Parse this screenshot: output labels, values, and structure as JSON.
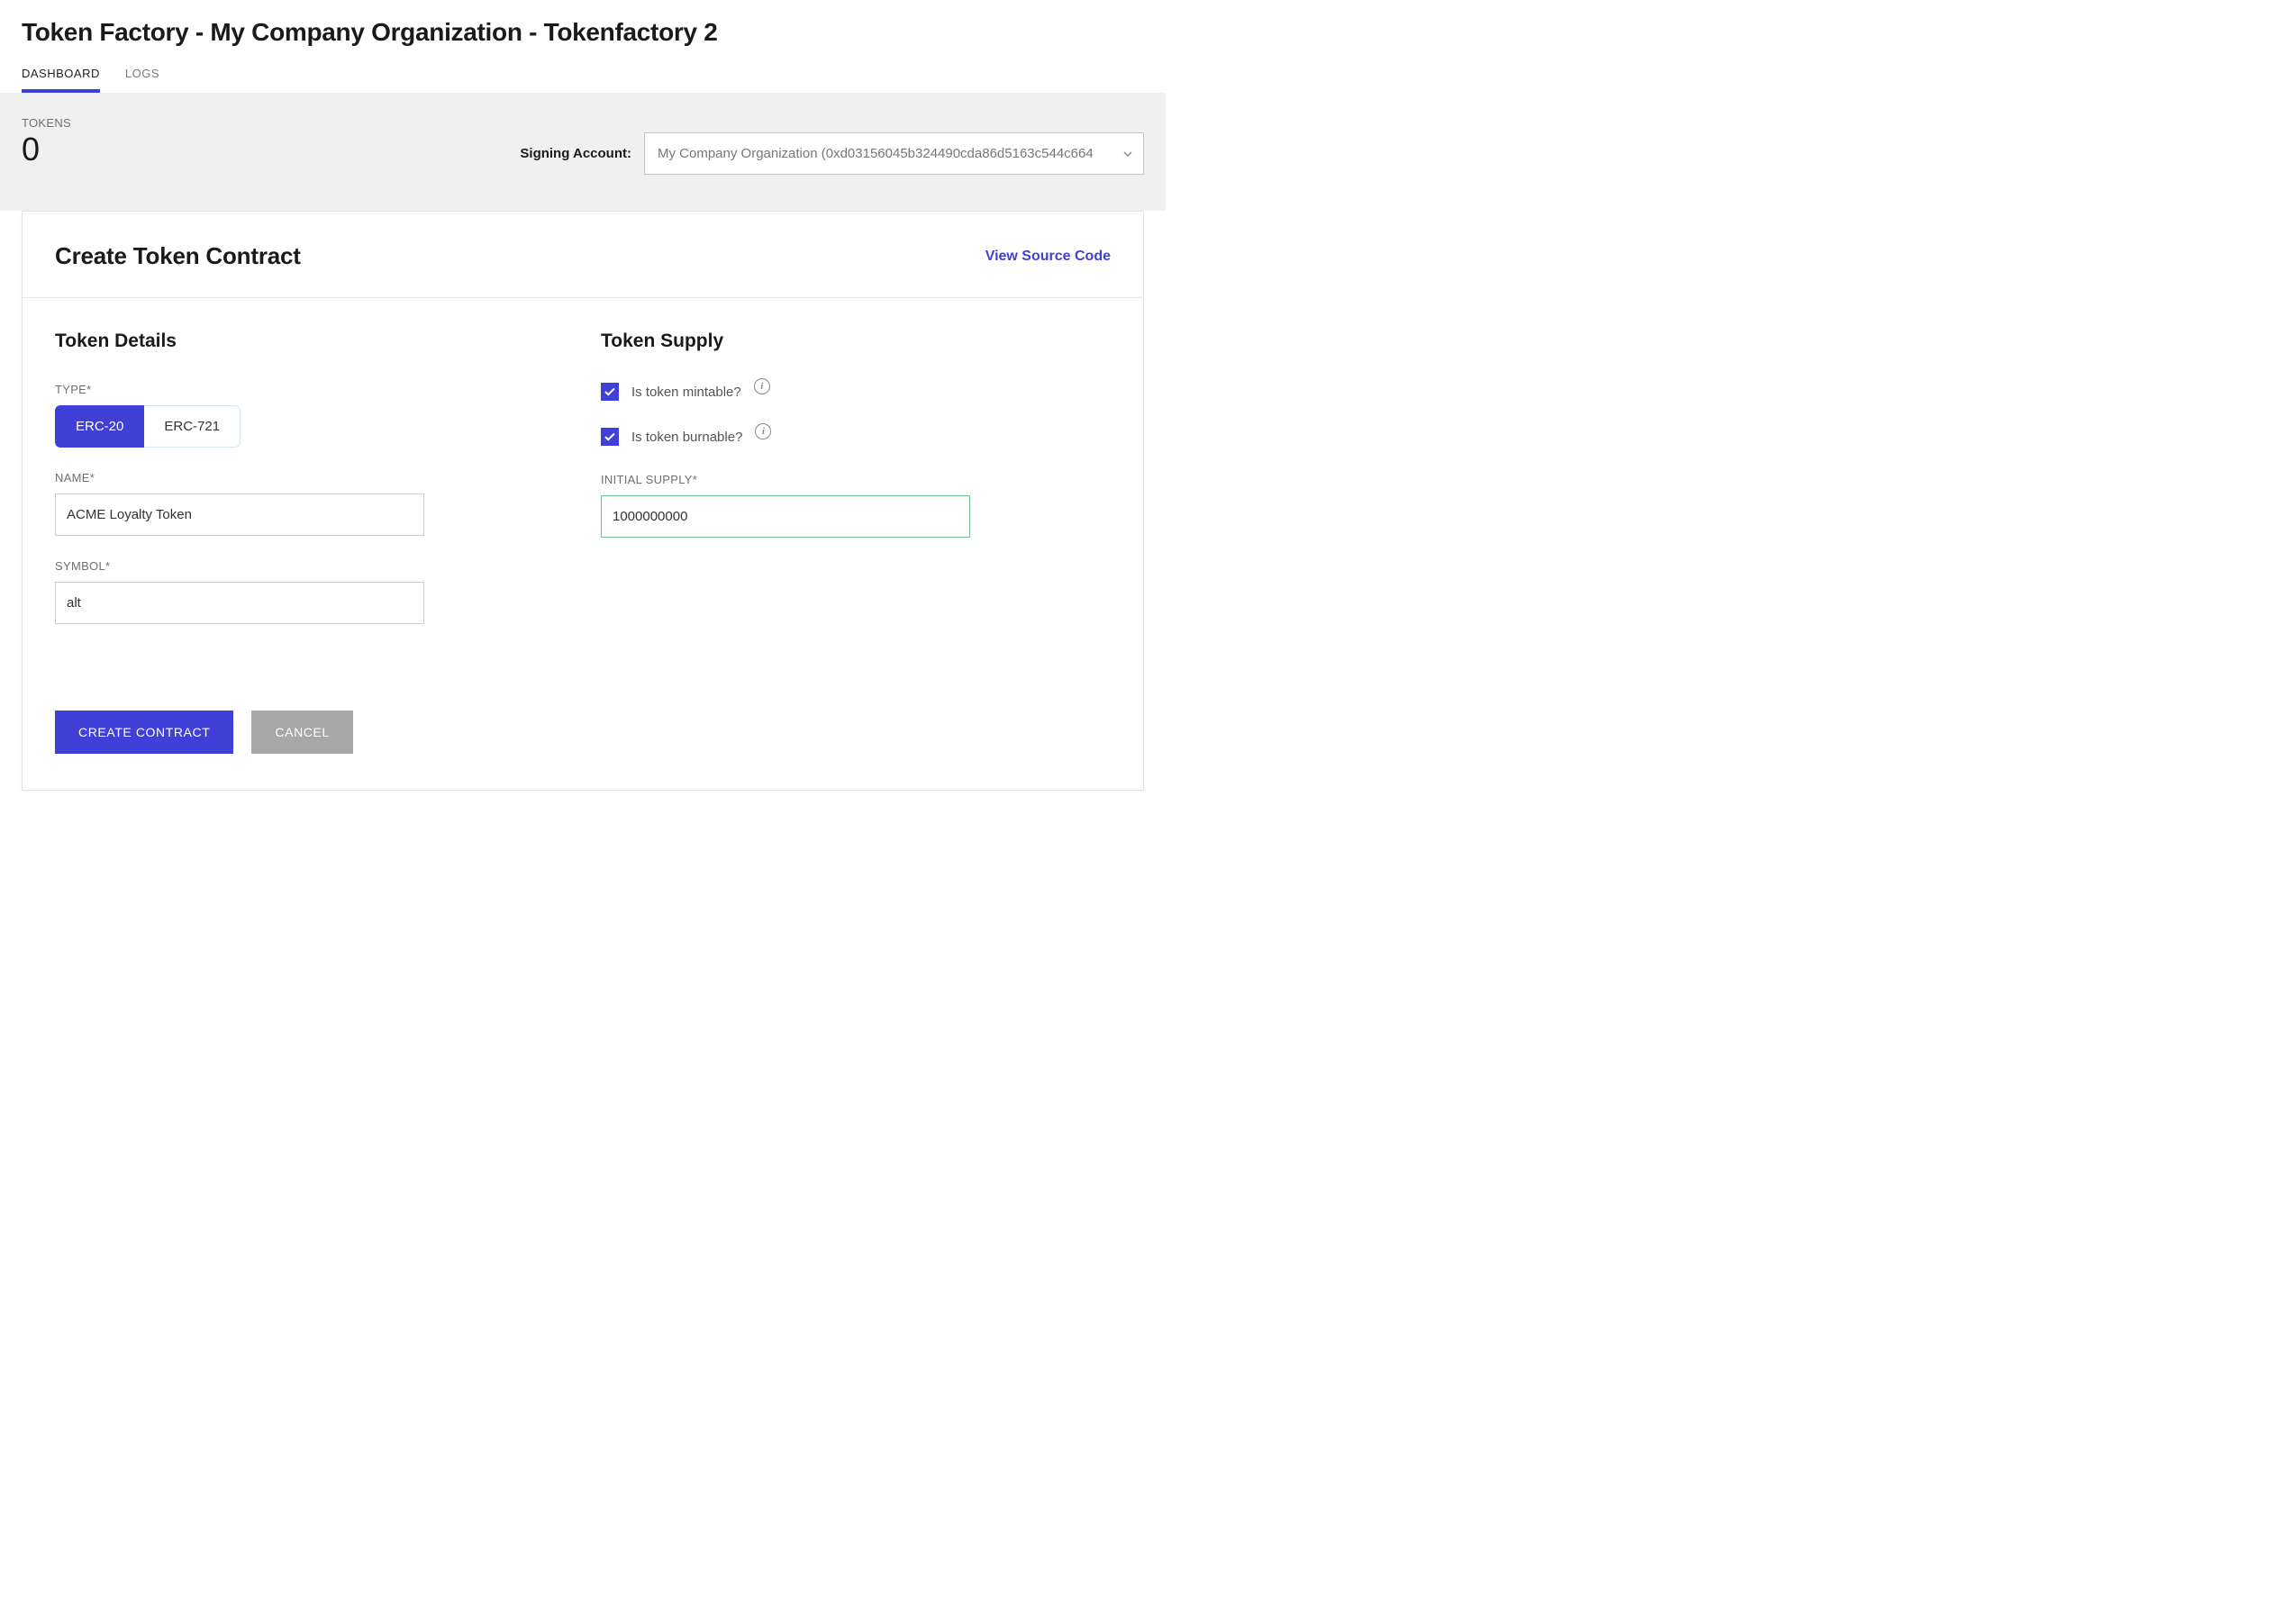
{
  "header": {
    "title": "Token Factory - My Company Organization - Tokenfactory 2"
  },
  "tabs": [
    {
      "label": "DASHBOARD",
      "active": true
    },
    {
      "label": "LOGS",
      "active": false
    }
  ],
  "stats": {
    "tokens_label": "TOKENS",
    "tokens_value": "0",
    "signing_label": "Signing Account:",
    "signing_value": "My Company Organization (0xd03156045b324490cda86d5163c544c664"
  },
  "card": {
    "title": "Create Token Contract",
    "view_source": "View Source Code"
  },
  "details": {
    "section_title": "Token Details",
    "type_label": "TYPE*",
    "type_options": [
      "ERC-20",
      "ERC-721"
    ],
    "type_selected": "ERC-20",
    "name_label": "NAME*",
    "name_value": "ACME Loyalty Token",
    "symbol_label": "SYMBOL*",
    "symbol_value": "alt"
  },
  "supply": {
    "section_title": "Token Supply",
    "mintable_label": "Is token mintable?",
    "mintable_checked": true,
    "burnable_label": "Is token burnable?",
    "burnable_checked": true,
    "initial_supply_label": "INITIAL SUPPLY*",
    "initial_supply_value": "1000000000"
  },
  "actions": {
    "create": "CREATE CONTRACT",
    "cancel": "CANCEL"
  },
  "icons": {
    "info": "i"
  }
}
